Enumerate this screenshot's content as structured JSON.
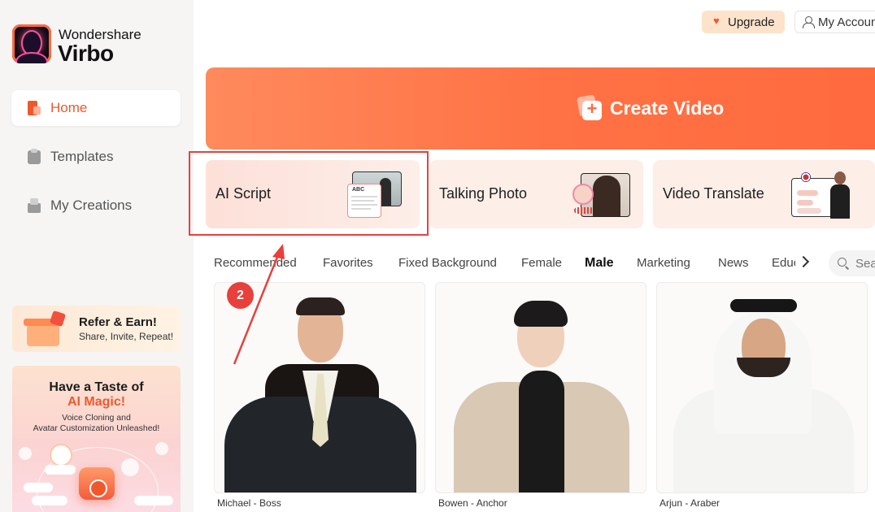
{
  "brand": {
    "top": "Wondershare",
    "bottom": "Virbo"
  },
  "sidebar": {
    "items": [
      {
        "label": "Home",
        "active": true
      },
      {
        "label": "Templates",
        "active": false
      },
      {
        "label": "My Creations",
        "active": false
      }
    ],
    "refer": {
      "title": "Refer & Earn!",
      "subtitle": "Share, Invite, Repeat!"
    },
    "promo": {
      "line1": "Have a Taste of",
      "line2": "AI Magic!",
      "line3": "Voice Cloning and",
      "line4": "Avatar Customization Unleashed!"
    }
  },
  "header": {
    "upgrade_label": "Upgrade",
    "account_label": "My Account"
  },
  "create_video": {
    "label": "Create Video"
  },
  "features": [
    {
      "label": "AI Script"
    },
    {
      "label": "Talking Photo"
    },
    {
      "label": "Video Translate"
    }
  ],
  "thumb_ai": {
    "abc": "ABC"
  },
  "filters": {
    "tabs": [
      "Recommended",
      "Favorites",
      "Fixed Background",
      "Female",
      "Male",
      "Marketing",
      "News",
      "Education"
    ],
    "active": "Male"
  },
  "search": {
    "placeholder": "Search"
  },
  "avatars": [
    {
      "name": "Michael - Boss"
    },
    {
      "name": "Bowen - Anchor"
    },
    {
      "name": "Arjun - Araber"
    }
  ],
  "annotation": {
    "step": "2"
  },
  "colors": {
    "accent": "#f0582c",
    "highlight": "#e8403b",
    "create_bg": "#ff7245"
  }
}
